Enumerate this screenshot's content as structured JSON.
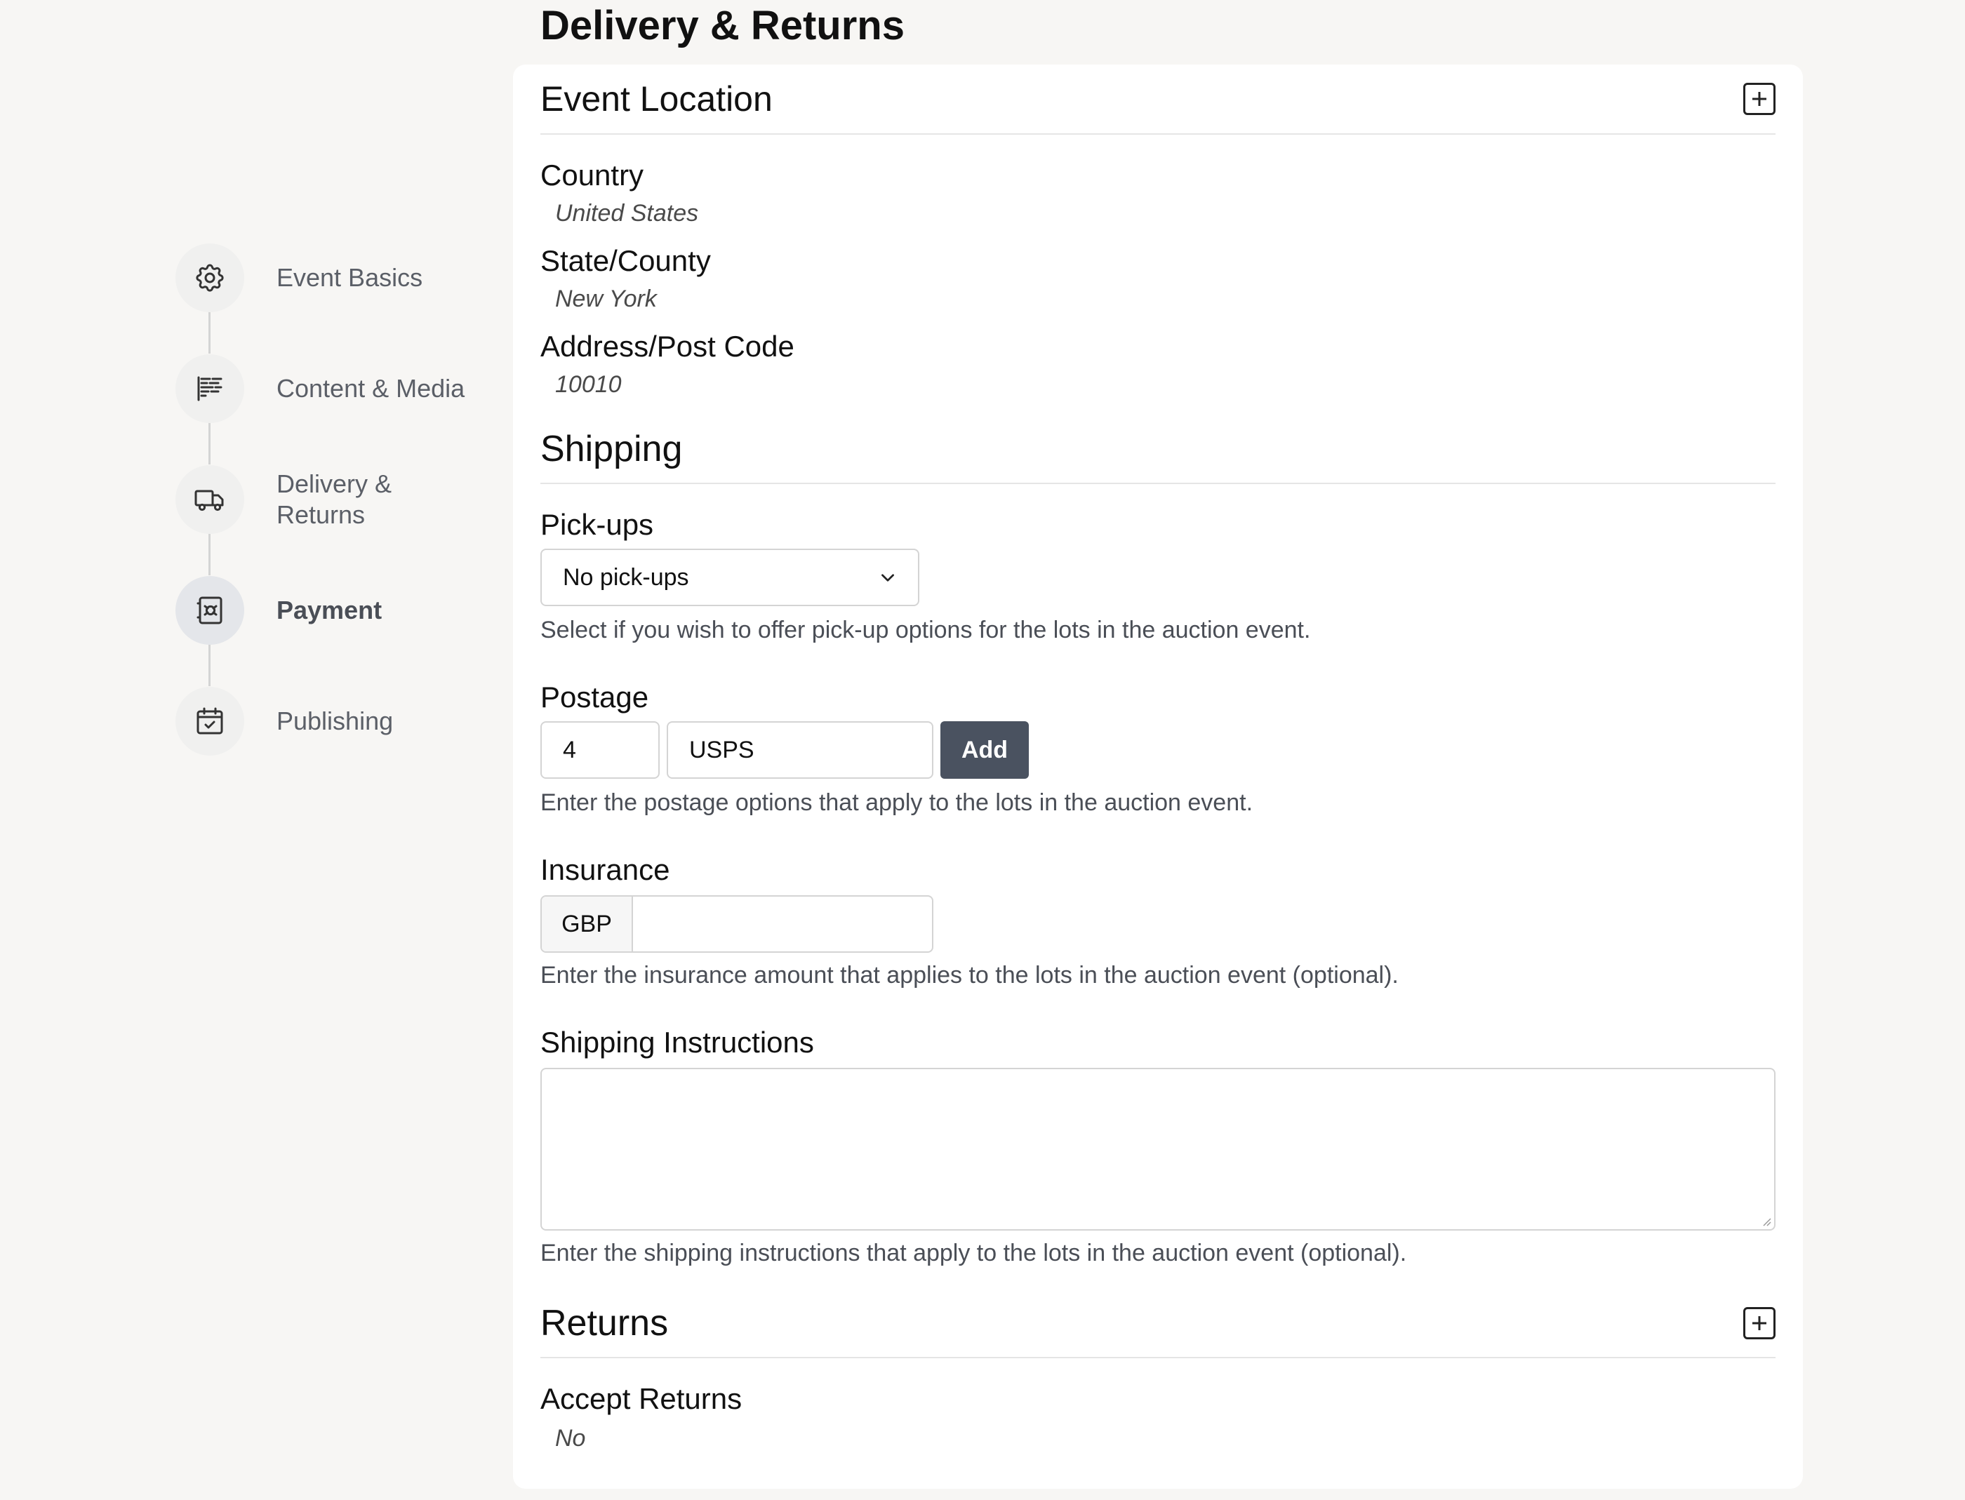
{
  "page_title": "Delivery & Returns",
  "steps": [
    {
      "label": "Event Basics",
      "icon": "gear-icon",
      "active": false
    },
    {
      "label": "Content & Media",
      "icon": "text-lines-icon",
      "active": false
    },
    {
      "label": "Delivery &\nReturns",
      "icon": "truck-icon",
      "active": false
    },
    {
      "label": "Payment",
      "icon": "safe-icon",
      "active": true
    },
    {
      "label": "Publishing",
      "icon": "calendar-check-icon",
      "active": false
    }
  ],
  "event_location": {
    "title": "Event Location",
    "country_label": "Country",
    "country_value": "United States",
    "state_label": "State/County",
    "state_value": "New York",
    "address_label": "Address/Post Code",
    "address_value": "10010"
  },
  "shipping": {
    "title": "Shipping",
    "pickups_label": "Pick-ups",
    "pickups_selected": "No pick-ups",
    "pickups_help": "Select if you wish to offer pick-up options for the lots in the auction event.",
    "postage_label": "Postage",
    "postage_amount": "4",
    "postage_carrier": "USPS",
    "add_label": "Add",
    "postage_help": "Enter the postage options that apply to the lots in the auction event.",
    "insurance_label": "Insurance",
    "insurance_currency": "GBP",
    "insurance_value": "",
    "insurance_help": "Enter the insurance amount that applies to the lots in the auction event (optional).",
    "instructions_label": "Shipping Instructions",
    "instructions_value": "",
    "instructions_help": "Enter the shipping instructions that apply to the lots in the auction event (optional)."
  },
  "returns": {
    "title": "Returns",
    "accept_label": "Accept Returns",
    "accept_value": "No"
  },
  "colors": {
    "accent_button": "#4a5260",
    "background": "#f7f6f4",
    "card": "#ffffff"
  }
}
